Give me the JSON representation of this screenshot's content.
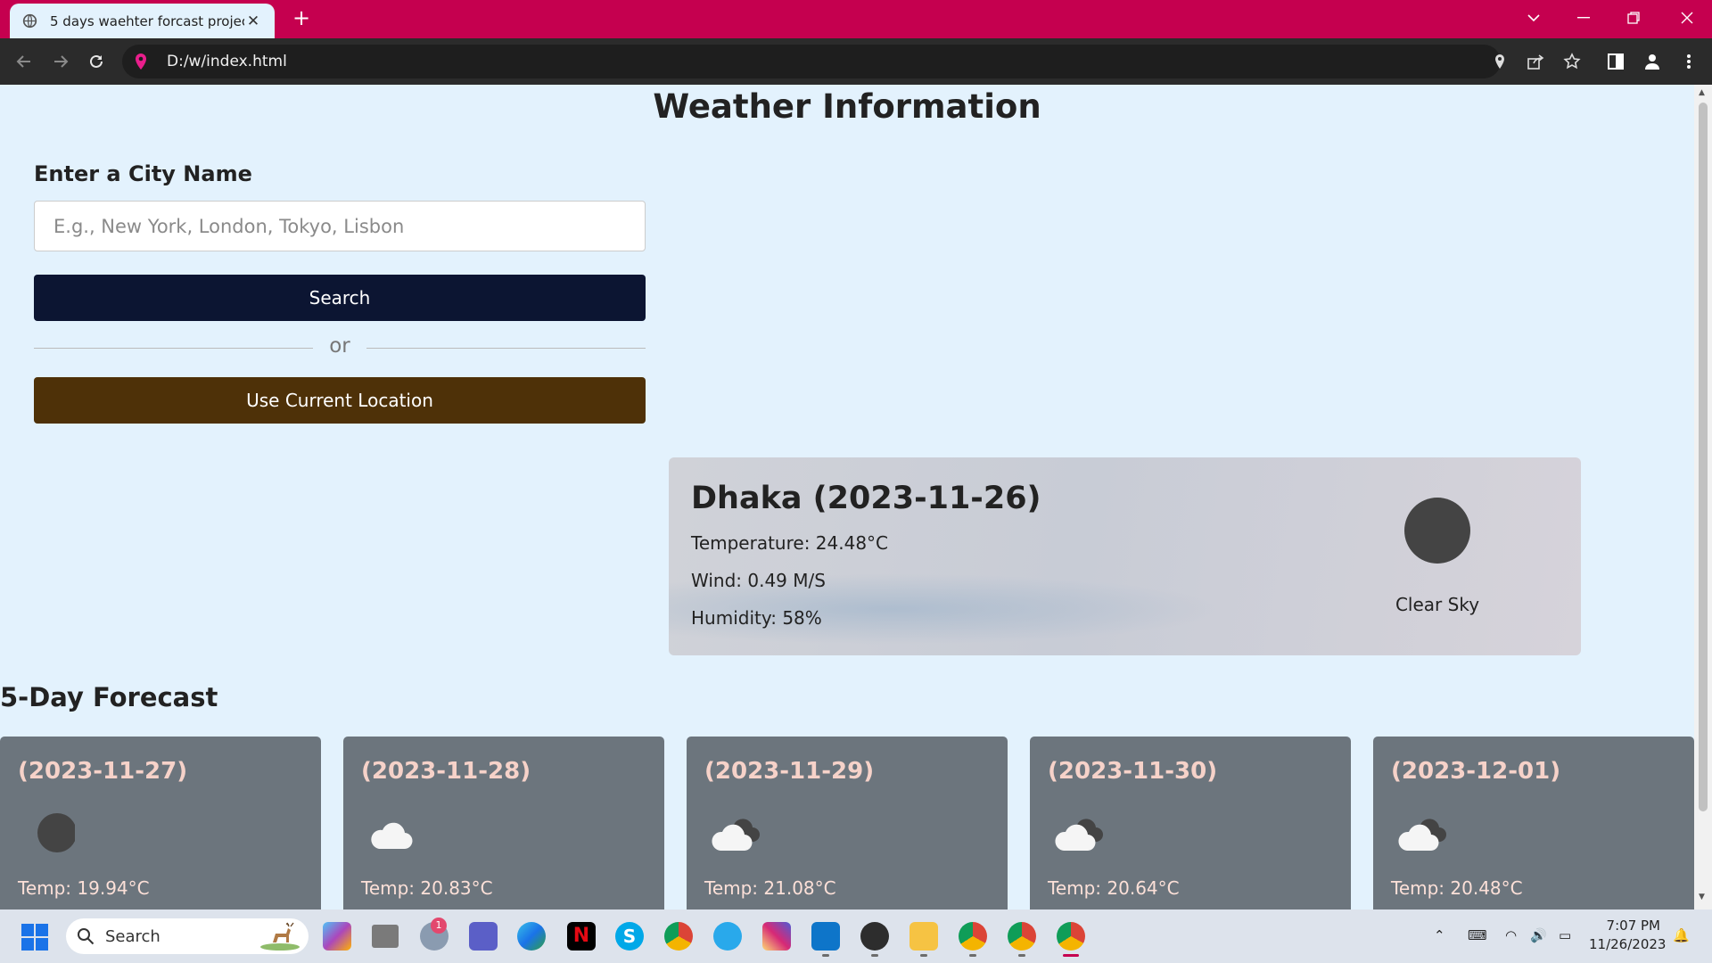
{
  "browser": {
    "tab_title": "5 days waehter forcast project",
    "url": "D:/w/index.html"
  },
  "page": {
    "title": "Weather Information",
    "city_label": "Enter a City Name",
    "input_placeholder": "E.g., New York, London, Tokyo, Lisbon",
    "search_label": "Search",
    "or_label": "or",
    "location_label": "Use Current Location"
  },
  "current": {
    "city": "Dhaka (2023-11-26)",
    "temperature": "Temperature: 24.48°C",
    "wind": "Wind: 0.49 M/S",
    "humidity": "Humidity: 58%",
    "description": "Clear Sky",
    "icon": "clear-sky-icon"
  },
  "forecast": {
    "title": "5-Day Forecast",
    "days": [
      {
        "date": "(2023-11-27)",
        "temp": "Temp: 19.94°C",
        "icon": "clear-sky-icon"
      },
      {
        "date": "(2023-11-28)",
        "temp": "Temp: 20.83°C",
        "icon": "cloud-icon"
      },
      {
        "date": "(2023-11-29)",
        "temp": "Temp: 21.08°C",
        "icon": "broken-clouds-icon"
      },
      {
        "date": "(2023-11-30)",
        "temp": "Temp: 20.64°C",
        "icon": "broken-clouds-icon"
      },
      {
        "date": "(2023-12-01)",
        "temp": "Temp: 20.48°C",
        "icon": "broken-clouds-icon"
      }
    ]
  },
  "taskbar": {
    "search_label": "Search",
    "time": "7:07 PM",
    "date": "11/26/2023",
    "mail_badge": "1"
  },
  "colors": {
    "browser_frame": "#c5004f",
    "page_background": "#e3f2fd",
    "search_button": "#0c1532",
    "location_button": "#4e3108",
    "forecast_card": "#6c757d",
    "forecast_text": "#f6d2c9"
  }
}
